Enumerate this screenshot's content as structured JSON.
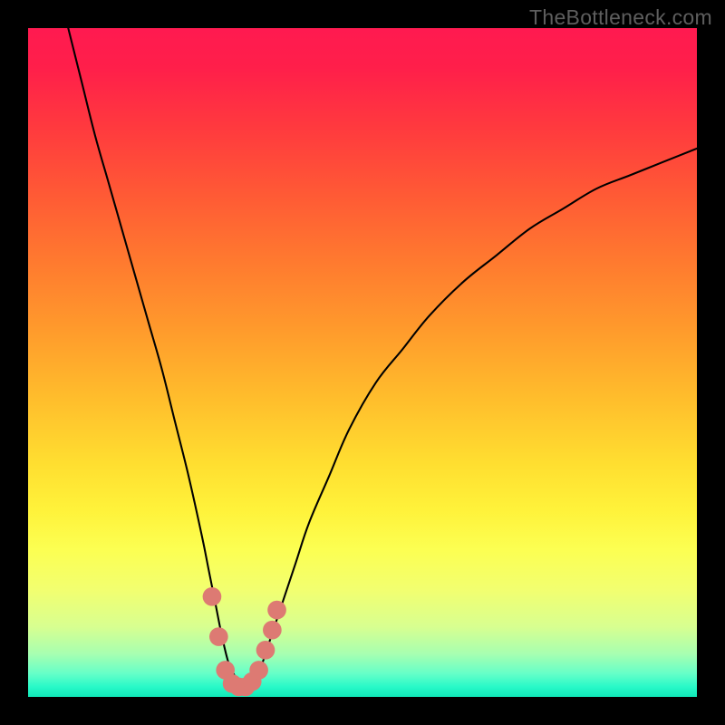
{
  "watermark": "TheBottleneck.com",
  "chart_data": {
    "type": "line",
    "title": "",
    "xlabel": "",
    "ylabel": "",
    "xlim": [
      0,
      100
    ],
    "ylim": [
      0,
      100
    ],
    "background_gradient_stops": [
      {
        "offset": 0.0,
        "color": "#ff1a50"
      },
      {
        "offset": 0.06,
        "color": "#ff1f4a"
      },
      {
        "offset": 0.15,
        "color": "#ff3a3e"
      },
      {
        "offset": 0.25,
        "color": "#ff5a35"
      },
      {
        "offset": 0.35,
        "color": "#ff7a2f"
      },
      {
        "offset": 0.45,
        "color": "#ff9a2c"
      },
      {
        "offset": 0.55,
        "color": "#ffbc2c"
      },
      {
        "offset": 0.65,
        "color": "#ffde30"
      },
      {
        "offset": 0.72,
        "color": "#fff23a"
      },
      {
        "offset": 0.78,
        "color": "#fcff52"
      },
      {
        "offset": 0.84,
        "color": "#f2ff70"
      },
      {
        "offset": 0.895,
        "color": "#d8ff90"
      },
      {
        "offset": 0.935,
        "color": "#a8ffb0"
      },
      {
        "offset": 0.965,
        "color": "#66ffc8"
      },
      {
        "offset": 0.985,
        "color": "#28f9c8"
      },
      {
        "offset": 1.0,
        "color": "#10e8b8"
      }
    ],
    "series": [
      {
        "name": "bottleneck-curve",
        "x": [
          6,
          8,
          10,
          12,
          14,
          16,
          18,
          20,
          22,
          24,
          26,
          27,
          28,
          29,
          30,
          31,
          32,
          33,
          34,
          35,
          36,
          38,
          40,
          42,
          45,
          48,
          52,
          56,
          60,
          65,
          70,
          75,
          80,
          85,
          90,
          95,
          100
        ],
        "y": [
          100,
          92,
          84,
          77,
          70,
          63,
          56,
          49,
          41,
          33,
          24,
          19,
          14,
          9,
          5,
          3,
          2,
          2,
          3,
          5,
          8,
          14,
          20,
          26,
          33,
          40,
          47,
          52,
          57,
          62,
          66,
          70,
          73,
          76,
          78,
          80,
          82
        ]
      }
    ],
    "markers": {
      "name": "highlight-points",
      "color": "#dd7a73",
      "radius": 1.4,
      "points": [
        {
          "x": 27.5,
          "y": 15.0
        },
        {
          "x": 28.5,
          "y": 9.0
        },
        {
          "x": 29.5,
          "y": 4.0
        },
        {
          "x": 30.5,
          "y": 2.0
        },
        {
          "x": 31.5,
          "y": 1.5
        },
        {
          "x": 32.5,
          "y": 1.5
        },
        {
          "x": 33.5,
          "y": 2.3
        },
        {
          "x": 34.5,
          "y": 4.0
        },
        {
          "x": 35.5,
          "y": 7.0
        },
        {
          "x": 36.5,
          "y": 10.0
        },
        {
          "x": 37.2,
          "y": 13.0
        }
      ]
    }
  }
}
